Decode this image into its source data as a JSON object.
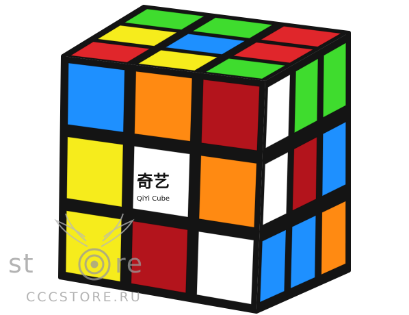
{
  "cube": {
    "brand_cn": "奇艺",
    "brand_en": "QiYi Cube",
    "colors": {
      "body": "#141414",
      "red": "#e0262b",
      "dark_red": "#b3141c",
      "green": "#3fdc2e",
      "yellow": "#f6ec1c",
      "blue": "#1e90ff",
      "orange": "#ff8a12",
      "white": "#ffffff"
    },
    "top_face": [
      [
        "green",
        "green",
        "red"
      ],
      [
        "yellow",
        "blue",
        "red"
      ],
      [
        "red",
        "yellow",
        "green"
      ]
    ],
    "front_face": [
      [
        "blue",
        "orange",
        "dark_red"
      ],
      [
        "yellow",
        "white",
        "orange"
      ],
      [
        "yellow",
        "dark_red",
        "white"
      ]
    ],
    "right_face": [
      [
        "white",
        "green",
        "green"
      ],
      [
        "white",
        "dark_red",
        "blue"
      ],
      [
        "blue",
        "blue",
        "orange"
      ]
    ]
  },
  "watermark": {
    "word_left": "st",
    "word_right": "re",
    "domain": "CCCSTORE.RU"
  }
}
